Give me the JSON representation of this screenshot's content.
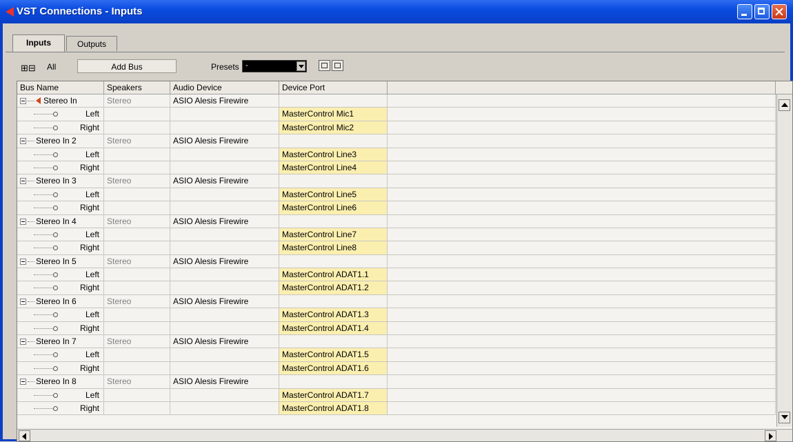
{
  "window": {
    "title": "VST Connections - Inputs",
    "app_icon": "cubase-icon",
    "controls": [
      "minimize-icon",
      "maximize-icon",
      "close-icon"
    ]
  },
  "tabs": [
    {
      "label": "Inputs",
      "active": true
    },
    {
      "label": "Outputs",
      "active": false
    }
  ],
  "toolbar": {
    "all_label": "All",
    "add_bus_label": "Add Bus",
    "presets_label": "Presets",
    "presets_value": "-"
  },
  "columns": [
    "Bus Name",
    "Speakers",
    "Audio Device",
    "Device Port"
  ],
  "rows": [
    {
      "kind": "bus",
      "name": "Stereo In",
      "speakers": "Stereo",
      "device": "ASIO Alesis Firewire",
      "port": "",
      "active": true
    },
    {
      "kind": "channel",
      "name": "Left",
      "port": "MasterControl Mic1"
    },
    {
      "kind": "channel",
      "name": "Right",
      "port": "MasterControl Mic2"
    },
    {
      "kind": "bus",
      "name": "Stereo In 2",
      "speakers": "Stereo",
      "device": "ASIO Alesis Firewire",
      "port": ""
    },
    {
      "kind": "channel",
      "name": "Left",
      "port": "MasterControl Line3"
    },
    {
      "kind": "channel",
      "name": "Right",
      "port": "MasterControl Line4"
    },
    {
      "kind": "bus",
      "name": "Stereo In 3",
      "speakers": "Stereo",
      "device": "ASIO Alesis Firewire",
      "port": ""
    },
    {
      "kind": "channel",
      "name": "Left",
      "port": "MasterControl Line5"
    },
    {
      "kind": "channel",
      "name": "Right",
      "port": "MasterControl Line6"
    },
    {
      "kind": "bus",
      "name": "Stereo In 4",
      "speakers": "Stereo",
      "device": "ASIO Alesis Firewire",
      "port": ""
    },
    {
      "kind": "channel",
      "name": "Left",
      "port": "MasterControl Line7"
    },
    {
      "kind": "channel",
      "name": "Right",
      "port": "MasterControl Line8"
    },
    {
      "kind": "bus",
      "name": "Stereo In 5",
      "speakers": "Stereo",
      "device": "ASIO Alesis Firewire",
      "port": ""
    },
    {
      "kind": "channel",
      "name": "Left",
      "port": "MasterControl ADAT1.1"
    },
    {
      "kind": "channel",
      "name": "Right",
      "port": "MasterControl ADAT1.2"
    },
    {
      "kind": "bus",
      "name": "Stereo In 6",
      "speakers": "Stereo",
      "device": "ASIO Alesis Firewire",
      "port": ""
    },
    {
      "kind": "channel",
      "name": "Left",
      "port": "MasterControl ADAT1.3"
    },
    {
      "kind": "channel",
      "name": "Right",
      "port": "MasterControl ADAT1.4"
    },
    {
      "kind": "bus",
      "name": "Stereo In 7",
      "speakers": "Stereo",
      "device": "ASIO Alesis Firewire",
      "port": ""
    },
    {
      "kind": "channel",
      "name": "Left",
      "port": "MasterControl ADAT1.5"
    },
    {
      "kind": "channel",
      "name": "Right",
      "port": "MasterControl ADAT1.6"
    },
    {
      "kind": "bus",
      "name": "Stereo In 8",
      "speakers": "Stereo",
      "device": "ASIO Alesis Firewire",
      "port": ""
    },
    {
      "kind": "channel",
      "name": "Left",
      "port": "MasterControl ADAT1.7"
    },
    {
      "kind": "channel",
      "name": "Right",
      "port": "MasterControl ADAT1.8"
    }
  ]
}
